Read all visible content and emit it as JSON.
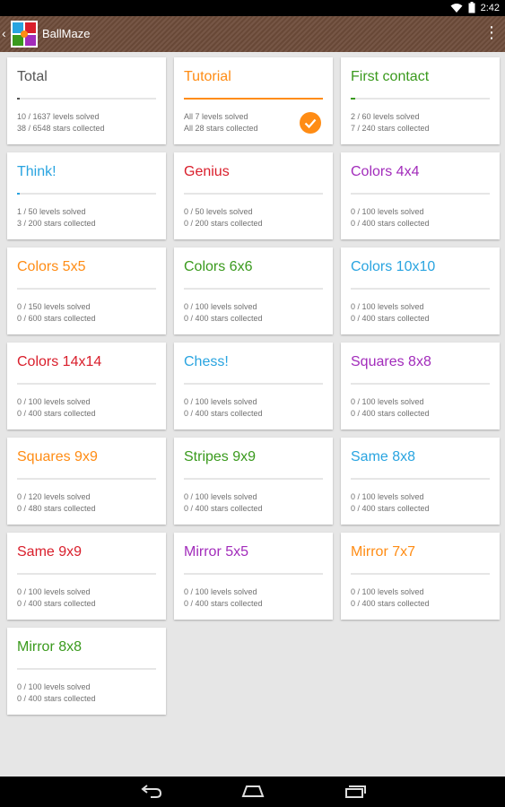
{
  "statusbar": {
    "time": "2:42",
    "wifi_icon": "wifi-icon",
    "battery_icon": "battery-icon"
  },
  "appbar": {
    "title": "BallMaze",
    "back_icon": "back-chevron-icon",
    "logo_icon": "ballmaze-logo-icon",
    "menu_icon": "overflow-menu-icon"
  },
  "cards": [
    {
      "name": "Total",
      "color": "#555555",
      "progress": 0.006,
      "line1": "10 / 1637 levels solved",
      "line2": "38 / 6548 stars collected"
    },
    {
      "name": "Tutorial",
      "color": "#ff8c14",
      "progress": 1.0,
      "line1": "All 7 levels solved",
      "line2": "All 28 stars collected",
      "completed": true
    },
    {
      "name": "First contact",
      "color": "#3a9a1d",
      "progress": 0.033,
      "line1": "2 / 60 levels solved",
      "line2": "7 / 240 stars collected"
    },
    {
      "name": "Think!",
      "color": "#29a4e0",
      "progress": 0.02,
      "line1": "1 / 50 levels solved",
      "line2": "3 / 200 stars collected"
    },
    {
      "name": "Genius",
      "color": "#d91e2b",
      "progress": 0,
      "line1": "0 / 50 levels solved",
      "line2": "0 / 200 stars collected"
    },
    {
      "name": "Colors 4x4",
      "color": "#a22cbb",
      "progress": 0,
      "line1": "0 / 100 levels solved",
      "line2": "0 / 400 stars collected"
    },
    {
      "name": "Colors 5x5",
      "color": "#ff8c14",
      "progress": 0,
      "line1": "0 / 150 levels solved",
      "line2": "0 / 600 stars collected"
    },
    {
      "name": "Colors 6x6",
      "color": "#3a9a1d",
      "progress": 0,
      "line1": "0 / 100 levels solved",
      "line2": "0 / 400 stars collected"
    },
    {
      "name": "Colors 10x10",
      "color": "#29a4e0",
      "progress": 0,
      "line1": "0 / 100 levels solved",
      "line2": "0 / 400 stars collected"
    },
    {
      "name": "Colors 14x14",
      "color": "#d91e2b",
      "progress": 0,
      "line1": "0 / 100 levels solved",
      "line2": "0 / 400 stars collected"
    },
    {
      "name": "Chess!",
      "color": "#29a4e0",
      "progress": 0,
      "line1": "0 / 100 levels solved",
      "line2": "0 / 400 stars collected"
    },
    {
      "name": "Squares 8x8",
      "color": "#a22cbb",
      "progress": 0,
      "line1": "0 / 100 levels solved",
      "line2": "0 / 400 stars collected"
    },
    {
      "name": "Squares 9x9",
      "color": "#ff8c14",
      "progress": 0,
      "line1": "0 / 120 levels solved",
      "line2": "0 / 480 stars collected"
    },
    {
      "name": "Stripes 9x9",
      "color": "#3a9a1d",
      "progress": 0,
      "line1": "0 / 100 levels solved",
      "line2": "0 / 400 stars collected"
    },
    {
      "name": "Same 8x8",
      "color": "#29a4e0",
      "progress": 0,
      "line1": "0 / 100 levels solved",
      "line2": "0 / 400 stars collected"
    },
    {
      "name": "Same 9x9",
      "color": "#d91e2b",
      "progress": 0,
      "line1": "0 / 100 levels solved",
      "line2": "0 / 400 stars collected"
    },
    {
      "name": "Mirror 5x5",
      "color": "#a22cbb",
      "progress": 0,
      "line1": "0 / 100 levels solved",
      "line2": "0 / 400 stars collected"
    },
    {
      "name": "Mirror 7x7",
      "color": "#ff8c14",
      "progress": 0,
      "line1": "0 / 100 levels solved",
      "line2": "0 / 400 stars collected"
    },
    {
      "name": "Mirror 8x8",
      "color": "#3a9a1d",
      "progress": 0,
      "line1": "0 / 100 levels solved",
      "line2": "0 / 400 stars collected"
    }
  ],
  "navbar": {
    "back_icon": "nav-back-icon",
    "home_icon": "nav-home-icon",
    "recents_icon": "nav-recents-icon"
  }
}
